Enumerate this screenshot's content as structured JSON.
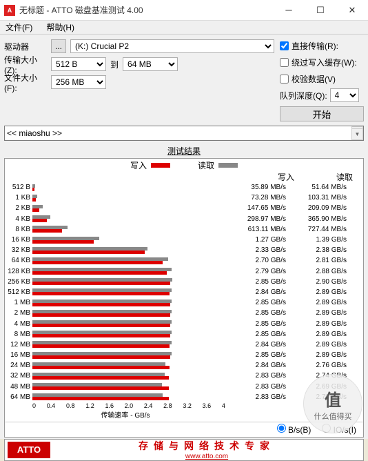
{
  "window": {
    "title": "无标题 - ATTO 磁盘基准测试 4.00",
    "icon_text": "A"
  },
  "menu": {
    "file": "文件(F)",
    "help": "帮助(H)"
  },
  "config": {
    "drive_label": "驱动器",
    "browse": "...",
    "drive_value": "(K:) Crucial P2",
    "xfer_label": "传输大小(Z):",
    "xfer_from": "512 B",
    "to": "到",
    "xfer_to": "64 MB",
    "file_label": "文件大小(F):",
    "file_value": "256 MB"
  },
  "options": {
    "direct": "直接传输(R):",
    "bypass": "绕过写入缓存(W):",
    "verify": "校验数据(V)",
    "qd_label": "队列深度(Q):",
    "qd_value": "4",
    "start": "开始",
    "direct_checked": true,
    "bypass_checked": false,
    "verify_checked": false
  },
  "textbox": "<< miaoshu >>",
  "results_title": "测试结果",
  "legend": {
    "write": "写入",
    "read": "读取"
  },
  "columns": {
    "write": "写入",
    "read": "读取"
  },
  "axis": {
    "ticks": [
      "0",
      "0.4",
      "0.8",
      "1.2",
      "1.6",
      "2.0",
      "2.4",
      "2.8",
      "3.2",
      "3.6",
      "4"
    ],
    "label": "传输速率 - GB/s"
  },
  "radio": {
    "bs": "B/s(B)",
    "ios": "IO/s(I)"
  },
  "footer": {
    "logo": "ATTO",
    "text": "存储与网络技术专家",
    "url": "www.atto.com"
  },
  "watermark": {
    "char": "值",
    "text": "什么值得买"
  },
  "chart_data": {
    "type": "bar",
    "title": "测试结果",
    "xlabel": "传输速率 - GB/s",
    "ylabel": "",
    "xlim": [
      0,
      4
    ],
    "categories": [
      "512 B",
      "1 KB",
      "2 KB",
      "4 KB",
      "8 KB",
      "16 KB",
      "32 KB",
      "64 KB",
      "128 KB",
      "256 KB",
      "512 KB",
      "1 MB",
      "2 MB",
      "4 MB",
      "8 MB",
      "12 MB",
      "16 MB",
      "24 MB",
      "32 MB",
      "48 MB",
      "64 MB"
    ],
    "series": [
      {
        "name": "写入",
        "unit": "GB/s",
        "display": [
          "35.89 MB/s",
          "73.28 MB/s",
          "147.65 MB/s",
          "298.97 MB/s",
          "613.11 MB/s",
          "1.27 GB/s",
          "2.33 GB/s",
          "2.70 GB/s",
          "2.79 GB/s",
          "2.85 GB/s",
          "2.84 GB/s",
          "2.85 GB/s",
          "2.85 GB/s",
          "2.85 GB/s",
          "2.85 GB/s",
          "2.84 GB/s",
          "2.85 GB/s",
          "2.84 GB/s",
          "2.83 GB/s",
          "2.83 GB/s",
          "2.83 GB/s"
        ],
        "values": [
          0.03589,
          0.07328,
          0.14765,
          0.29897,
          0.61311,
          1.27,
          2.33,
          2.7,
          2.79,
          2.85,
          2.84,
          2.85,
          2.85,
          2.85,
          2.85,
          2.84,
          2.85,
          2.84,
          2.83,
          2.83,
          2.83
        ]
      },
      {
        "name": "读取",
        "unit": "GB/s",
        "display": [
          "51.64 MB/s",
          "103.31 MB/s",
          "209.09 MB/s",
          "365.90 MB/s",
          "727.44 MB/s",
          "1.39 GB/s",
          "2.38 GB/s",
          "2.81 GB/s",
          "2.88 GB/s",
          "2.90 GB/s",
          "2.89 GB/s",
          "2.89 GB/s",
          "2.89 GB/s",
          "2.89 GB/s",
          "2.89 GB/s",
          "2.89 GB/s",
          "2.89 GB/s",
          "2.76 GB/s",
          "2.74 GB/s",
          "2.69 GB/s",
          "2.70 GB/s"
        ],
        "values": [
          0.05164,
          0.10331,
          0.20909,
          0.3659,
          0.72744,
          1.39,
          2.38,
          2.81,
          2.88,
          2.9,
          2.89,
          2.89,
          2.89,
          2.89,
          2.89,
          2.89,
          2.89,
          2.76,
          2.74,
          2.69,
          2.7
        ]
      }
    ]
  }
}
